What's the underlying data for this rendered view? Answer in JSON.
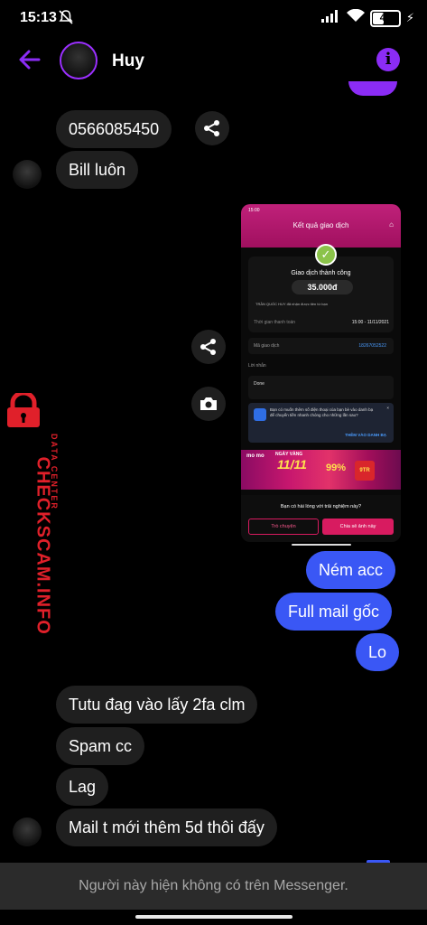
{
  "status_bar": {
    "time": "15:13",
    "battery": "42"
  },
  "header": {
    "name": "Huy"
  },
  "messages": {
    "m1": "0566085450",
    "m2": "Bill luôn",
    "m3": "Ném acc",
    "m4": "Full mail gốc",
    "m5": "Lo",
    "m6": "Tutu đag vào lấy 2fa clm",
    "m7": "Spam cc",
    "m8": "Lag",
    "m9": "Mail t mới thêm 5d thôi đấy"
  },
  "screenshot": {
    "status_time": "15:00",
    "title": "Kết quả giao dịch",
    "success": "Giao dịch thành công",
    "amount": "35.000đ",
    "receiver_note": "TRẦN QUỐC HUY đã nhận được tiền từ bạn",
    "time_label": "Thời gian thanh toán",
    "time_value": "15:00 - 11/11/2021",
    "txn_label": "Mã giao dịch",
    "txn_value": "18267052522",
    "message_label": "Lời nhắn",
    "message_value": "Done",
    "tip_text": "Bạn có muốn thêm số điện thoại của bạn bè vào danh bạ để chuyển tiền nhanh chóng cho những lần sau?",
    "tip_link": "THÊM VÀO DANH BẠ",
    "banner_brand": "mo mo",
    "banner_ngay": "NGÀY VÀNG",
    "banner_big": "11/11",
    "banner_pct": "99%",
    "banner_prize": "9TR",
    "survey_q": "Bạn có hài lòng với trải nghiệm này?",
    "btn_chat": "Trò chuyện",
    "btn_share": "Chia sẻ ảnh này"
  },
  "watermark": {
    "site": "CHECKSCAM.INFO",
    "sub": "DATA CENTER"
  },
  "footer": {
    "notice": "Người này hiện không có trên Messenger."
  },
  "colors": {
    "accent": "#8b2cf5",
    "outgoing": "#3a57f5",
    "incoming": "#1f1f1f",
    "watermark": "#e0202a"
  }
}
